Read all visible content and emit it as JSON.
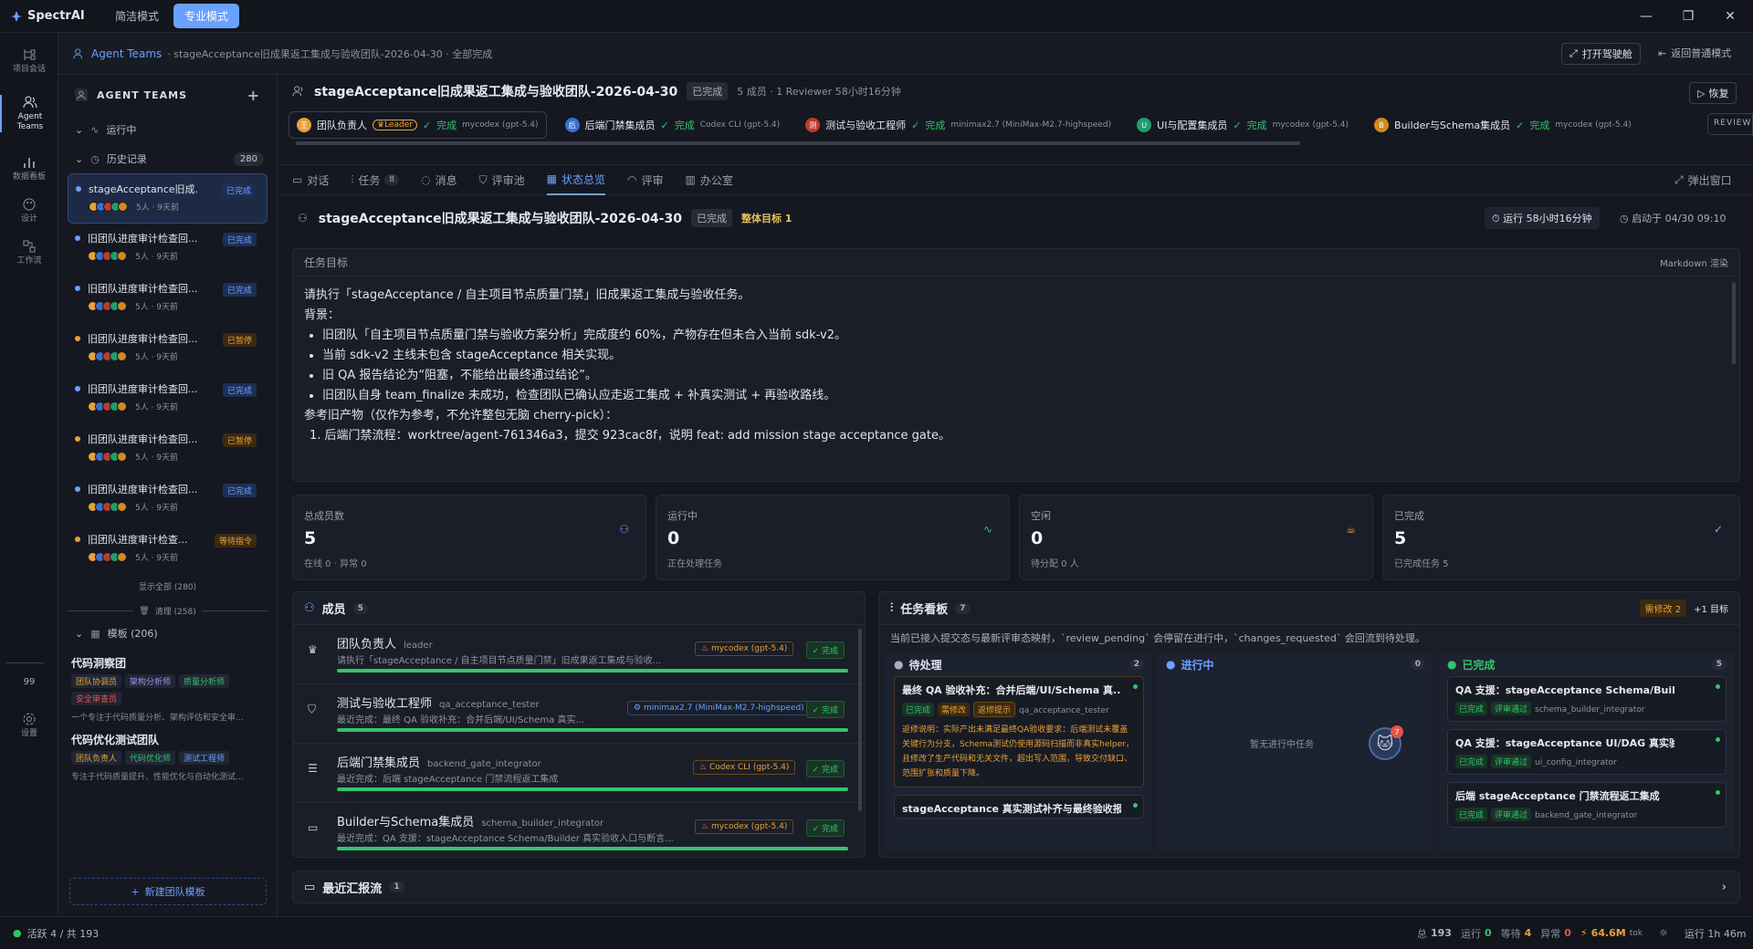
{
  "app": {
    "name": "SpectrAI",
    "modes": [
      "简洁模式",
      "专业模式"
    ]
  },
  "rail": [
    "项目会话",
    "Agent Teams",
    "数据看板",
    "设计",
    "工作流",
    "99",
    "设置"
  ],
  "sub": {
    "section": "Agent Teams",
    "crumb": "· stageAcceptance旧成果返工集成与验收团队-2026-04-30 · 全部完成",
    "drive": "打开驾驶舱",
    "back": "返回普通模式"
  },
  "side": {
    "title": "AGENT TEAMS",
    "running": "运行中",
    "history": "历史记录",
    "history_count": "280",
    "teams": [
      {
        "name": "stageAcceptance旧成...",
        "status": "已完成",
        "meta": "5人 · 9天前",
        "color": "#6aa1ff"
      },
      {
        "name": "旧团队进度审计检查回...",
        "status": "已完成",
        "meta": "5人 · 9天前",
        "color": "#6aa1ff"
      },
      {
        "name": "旧团队进度审计检查回...",
        "status": "已完成",
        "meta": "5人 · 9天前",
        "color": "#6aa1ff"
      },
      {
        "name": "旧团队进度审计检查回...",
        "status": "已暂停",
        "meta": "5人 · 9天前",
        "color": "#e8a13a"
      },
      {
        "name": "旧团队进度审计检查回...",
        "status": "已完成",
        "meta": "5人 · 9天前",
        "color": "#6aa1ff"
      },
      {
        "name": "旧团队进度审计检查回...",
        "status": "已暂停",
        "meta": "5人 · 9天前",
        "color": "#e8a13a"
      },
      {
        "name": "旧团队进度审计检查回...",
        "status": "已完成",
        "meta": "5人 · 9天前",
        "color": "#6aa1ff"
      },
      {
        "name": "旧团队进度审计检查...",
        "status": "等待指令",
        "meta": "5人 · 9天前",
        "color": "#e8a13a"
      }
    ],
    "show_all": "显示全部 (280)",
    "clean": "清理 (258)",
    "templates": "模板 (206)",
    "tmpl": [
      {
        "name": "代码洞察团",
        "chips": [
          "团队协调员",
          "架构分析师",
          "质量分析师",
          "安全审查员"
        ],
        "desc": "一个专注于代码质量分析、架构评估和安全审..."
      },
      {
        "name": "代码优化测试团队",
        "chips": [
          "团队负责人",
          "代码优化师",
          "测试工程师"
        ],
        "desc": "专注于代码质量提升、性能优化与自动化测试..."
      }
    ],
    "new_tmpl": "新建团队模板"
  },
  "team": {
    "title": "stageAcceptance旧成果返工集成与验收团队-2026-04-30",
    "status": "已完成",
    "meta": "5 成员 · 1 Reviewer  58小时16分钟",
    "restore": "恢复",
    "members": [
      {
        "name": "团队负责人",
        "tag": "Leader",
        "st": "完成",
        "model": "mycodex (gpt-5.4)",
        "c": "#e8a13a",
        "ic": "王"
      },
      {
        "name": "后端门禁集成员",
        "st": "完成",
        "model": "Codex CLI (gpt-5.4)",
        "c": "#3a6fd0",
        "ic": "后"
      },
      {
        "name": "测试与验收工程师",
        "st": "完成",
        "model": "minimax2.7 (MiniMax-M2.7-highspeed)",
        "c": "#c0392b",
        "ic": "测"
      },
      {
        "name": "UI与配置集成员",
        "st": "完成",
        "model": "mycodex (gpt-5.4)",
        "c": "#1f9e6e",
        "ic": "U"
      },
      {
        "name": "Builder与Schema集成员",
        "st": "完成",
        "model": "mycodex (gpt-5.4)",
        "c": "#d18b1f",
        "ic": "B"
      }
    ],
    "reviewer": "REVIEWE"
  },
  "tabs": [
    {
      "l": "对话"
    },
    {
      "l": "任务",
      "n": "8"
    },
    {
      "l": "消息"
    },
    {
      "l": "评审池"
    },
    {
      "l": "状态总览"
    },
    {
      "l": "评审"
    },
    {
      "l": "办公室"
    }
  ],
  "popout": "弹出窗口",
  "overview": {
    "title": "stageAcceptance旧成果返工集成与验收团队-2026-04-30",
    "status": "已完成",
    "goal": "整体目标 1",
    "run": "运行  58小时16分钟",
    "start": "启动于 04/30 09:10"
  },
  "goal": {
    "head": "任务目标",
    "md": "Markdown 渲染",
    "l1": "请执行「stageAcceptance / 自主项目节点质量门禁」旧成果返工集成与验收任务。",
    "l2": "背景：",
    "b": [
      "旧团队「自主项目节点质量门禁与验收方案分析」完成度约 60%，产物存在但未合入当前 sdk-v2。",
      "当前 sdk-v2 主线未包含 stageAcceptance 相关实现。",
      "旧 QA 报告结论为“阻塞，不能给出最终通过结论”。",
      "旧团队自身 team_finalize 未成功，检查团队已确认应走返工集成 + 补真实测试 + 再验收路线。"
    ],
    "l3": "参考旧产物（仅作为参考，不允许整包无脑 cherry-pick）：",
    "o1": "1. 后端门禁流程：worktree/agent-761346a3，提交 923cac8f，说明 feat: add mission stage acceptance gate。"
  },
  "stats": [
    {
      "l": "总成员数",
      "v": "5",
      "s": "在线 0 · 异常 0"
    },
    {
      "l": "运行中",
      "v": "0",
      "s": "正在处理任务"
    },
    {
      "l": "空闲",
      "v": "0",
      "s": "待分配 0 人"
    },
    {
      "l": "已完成",
      "v": "5",
      "s": "已完成任务 5"
    }
  ],
  "mem": {
    "title": "成员",
    "count": "5",
    "rows": [
      {
        "n": "团队负责人",
        "k": "leader",
        "s": "请执行「stageAcceptance / 自主项目节点质量门禁」旧成果返工集成与验收...",
        "m": "mycodex (gpt-5.4)",
        "st": "完成"
      },
      {
        "n": "测试与验收工程师",
        "k": "qa_acceptance_tester",
        "s": "最近完成：最终 QA 验收补充：合并后端/UI/Schema 真实...",
        "m": "minimax2.7 (MiniMax-M2.7-highspeed)",
        "st": "完成"
      },
      {
        "n": "后端门禁集成员",
        "k": "backend_gate_integrator",
        "s": "最近完成：后端 stageAcceptance 门禁流程返工集成",
        "m": "Codex CLI (gpt-5.4)",
        "st": "完成"
      },
      {
        "n": "Builder与Schema集成员",
        "k": "schema_builder_integrator",
        "s": "最近完成：QA 支援：stageAcceptance Schema/Builder 真实验收入口与断言...",
        "m": "mycodex (gpt-5.4)",
        "st": "完成"
      }
    ]
  },
  "kan": {
    "title": "任务看板",
    "count": "7",
    "need": "需修改 2",
    "plus": "+1 目标",
    "note": "当前已接入提交态与最新评审态映射，`review_pending` 会停留在进行中，`changes_requested` 会回流到待处理。",
    "todo": {
      "l": "待处理",
      "n": "2",
      "c1": "最终 QA 验收补充：合并后端/UI/Schema 真...",
      "tags": [
        "已完成",
        "需修改",
        "返修提示"
      ],
      "owner": "qa_acceptance_tester",
      "fix": "返修说明：实际产出未满足最终QA验收要求：后端测试未覆盖关键行为分支，Schema测试仍使用源码扫描而非真实helper，且修改了生产代码和无关文件，超出写入范围，导致交付缺口、范围扩张和质量下降。",
      "c2": "stageAcceptance 真实测试补齐与最终验收报..."
    },
    "doing": {
      "l": "进行中",
      "n": "0",
      "empty": "暂无进行中任务",
      "badge": "7"
    },
    "done": {
      "l": "已完成",
      "n": "5",
      "cards": [
        {
          "t": "QA 支援：stageAcceptance Schema/Builder...",
          "tags": [
            "已完成",
            "评审通过"
          ],
          "o": "schema_builder_integrator"
        },
        {
          "t": "QA 支援：stageAcceptance UI/DAG 真实验...",
          "tags": [
            "已完成",
            "评审通过"
          ],
          "o": "ui_config_integrator"
        },
        {
          "t": "后端 stageAcceptance 门禁流程返工集成",
          "tags": [
            "已完成",
            "评审通过"
          ],
          "o": "backend_gate_integrator"
        }
      ]
    }
  },
  "report": {
    "l": "最近汇报流",
    "n": "1"
  },
  "foot": {
    "active": "活跃 4 / 共 193",
    "total": "总",
    "total_v": "193",
    "run": "运行",
    "run_v": "0",
    "wait": "等待",
    "wait_v": "4",
    "err": "异常",
    "err_v": "0",
    "tok": "64.6M",
    "tok_u": "tok",
    "uptime": "运行 1h 46m"
  }
}
